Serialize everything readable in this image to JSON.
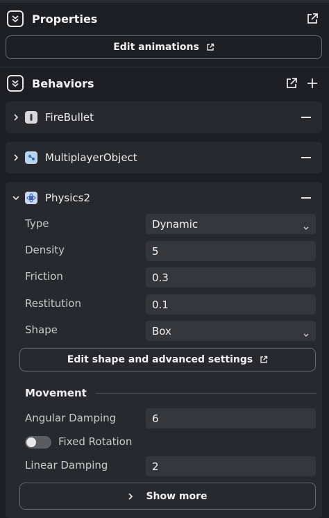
{
  "properties": {
    "title": "Properties",
    "edit_animations_label": "Edit animations"
  },
  "behaviors": {
    "title": "Behaviors",
    "items": [
      {
        "name": "FireBullet",
        "icon": "bullet-icon",
        "expanded": false
      },
      {
        "name": "MultiplayerObject",
        "icon": "multiplayer-icon",
        "expanded": false
      },
      {
        "name": "Physics2",
        "icon": "physics-icon",
        "expanded": true
      }
    ]
  },
  "physics": {
    "type_label": "Type",
    "type_value": "Dynamic",
    "density_label": "Density",
    "density_value": "5",
    "friction_label": "Friction",
    "friction_value": "0.3",
    "restitution_label": "Restitution",
    "restitution_value": "0.1",
    "shape_label": "Shape",
    "shape_value": "Box",
    "edit_shape_label": "Edit shape and advanced settings",
    "movement_title": "Movement",
    "angular_damping_label": "Angular Damping",
    "angular_damping_value": "6",
    "fixed_rotation_label": "Fixed Rotation",
    "fixed_rotation_on": false,
    "linear_damping_label": "Linear Damping",
    "linear_damping_value": "2",
    "show_more_label": "Show more"
  },
  "colors": {
    "background": "#1d1f24",
    "card": "#27292e",
    "field": "#34363c",
    "text": "#e8e8ea"
  }
}
